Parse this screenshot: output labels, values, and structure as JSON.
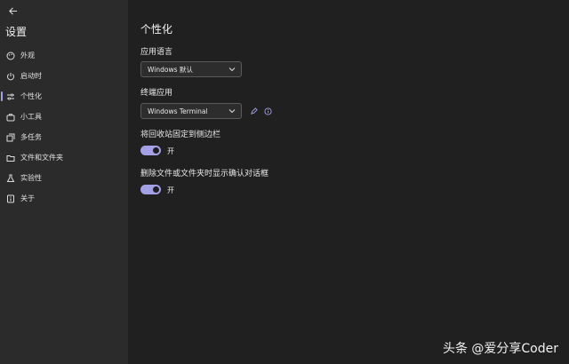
{
  "app": {
    "title": "设置"
  },
  "sidebar": {
    "items": [
      {
        "label": "外观",
        "icon": "palette-icon"
      },
      {
        "label": "启动时",
        "icon": "power-icon"
      },
      {
        "label": "个性化",
        "icon": "sliders-icon",
        "active": true
      },
      {
        "label": "小工具",
        "icon": "briefcase-icon"
      },
      {
        "label": "多任务",
        "icon": "layers-icon"
      },
      {
        "label": "文件和文件夹",
        "icon": "folder-icon"
      },
      {
        "label": "实验性",
        "icon": "flask-icon"
      },
      {
        "label": "关于",
        "icon": "info-card-icon"
      }
    ]
  },
  "main": {
    "title": "个性化",
    "language": {
      "label": "应用语言",
      "value": "Windows 默认"
    },
    "terminal": {
      "label": "终端应用",
      "value": "Windows Terminal"
    },
    "pin_recycle": {
      "label": "将回收站固定到侧边栏",
      "state_text": "开",
      "on": true
    },
    "confirm_delete": {
      "label": "删除文件或文件夹时显示确认对话框",
      "state_text": "开",
      "on": true
    }
  },
  "watermark": "头条 @爱分享Coder",
  "colors": {
    "accent": "#a3a0e6",
    "sidebar_bg": "#2b2b2b",
    "main_bg": "#202020"
  }
}
